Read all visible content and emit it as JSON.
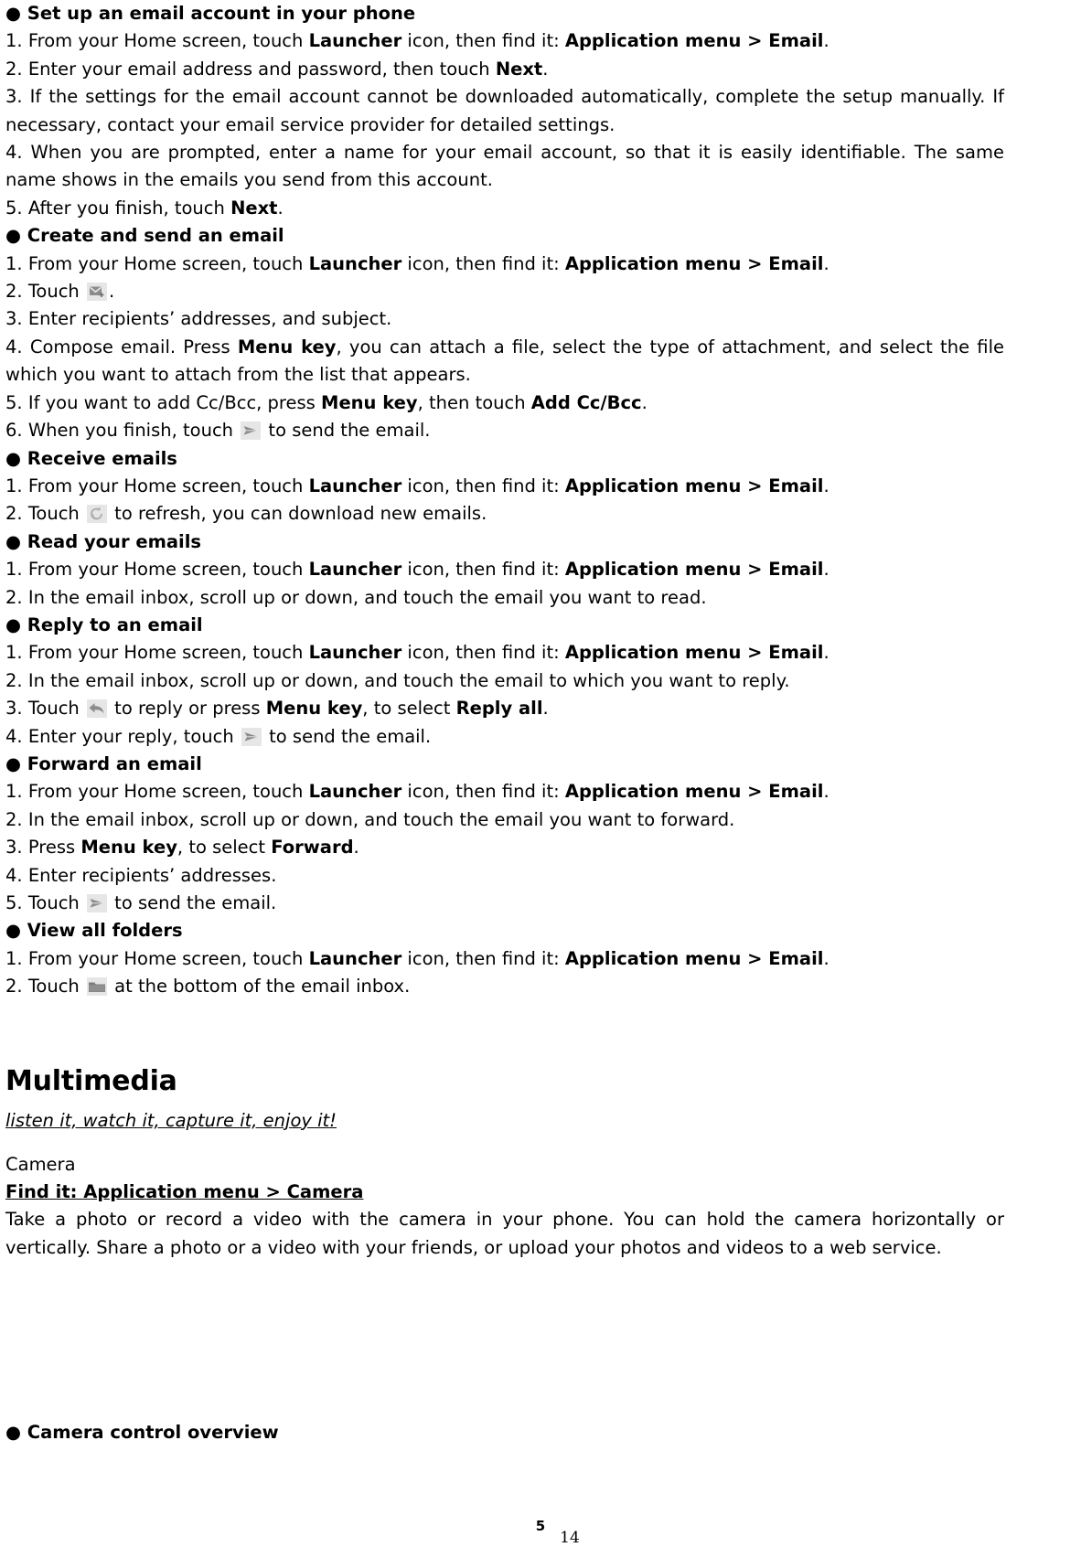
{
  "document": {
    "page_label_inner": "5",
    "page_label_outer": "14"
  },
  "sections": [
    {
      "heading": "● Set up an email account in your phone",
      "steps": [
        {
          "num": "1. ",
          "parts": [
            {
              "t": "From your Home screen, touch ",
              "b": false
            },
            {
              "t": "Launcher",
              "b": true
            },
            {
              "t": " icon, then find it: ",
              "b": false
            },
            {
              "t": "Application menu > Email",
              "b": true
            },
            {
              "t": ".",
              "b": false
            }
          ]
        },
        {
          "num": "2. ",
          "parts": [
            {
              "t": "Enter your email address and password, then touch ",
              "b": false
            },
            {
              "t": "Next",
              "b": true
            },
            {
              "t": ".",
              "b": false
            }
          ]
        },
        {
          "num": "3. ",
          "parts": [
            {
              "t": "If the settings for the email account cannot be downloaded automatically, complete the setup manually. If necessary, contact your email service provider for detailed settings.",
              "b": false
            }
          ]
        },
        {
          "num": "4. ",
          "parts": [
            {
              "t": "When you are prompted, enter a name for your email account, so that it is easily identifiable. The same name shows in the emails you send from this account.",
              "b": false
            }
          ]
        },
        {
          "num": "5. ",
          "parts": [
            {
              "t": "After you finish, touch ",
              "b": false
            },
            {
              "t": "Next",
              "b": true
            },
            {
              "t": ".",
              "b": false
            }
          ]
        }
      ]
    },
    {
      "heading": "● Create and send an email",
      "steps": [
        {
          "num": "1. ",
          "parts": [
            {
              "t": "From your Home screen, touch ",
              "b": false
            },
            {
              "t": "Launcher",
              "b": true
            },
            {
              "t": " icon, then find it: ",
              "b": false
            },
            {
              "t": "Application menu > Email",
              "b": true
            },
            {
              "t": ".",
              "b": false
            }
          ]
        },
        {
          "num": "2. ",
          "parts": [
            {
              "t": "Touch ",
              "b": false
            },
            {
              "icon": "compose-email-icon"
            },
            {
              "t": ".",
              "b": false
            }
          ]
        },
        {
          "num": "3. ",
          "parts": [
            {
              "t": "Enter recipients’ addresses, and subject.",
              "b": false
            }
          ]
        },
        {
          "num": "4. ",
          "parts": [
            {
              "t": "Compose email. Press ",
              "b": false
            },
            {
              "t": "Menu key",
              "b": true
            },
            {
              "t": ", you can attach a file, select the type of attachment, and select the file which you want to attach from the list that appears.",
              "b": false
            }
          ]
        },
        {
          "num": "5. ",
          "parts": [
            {
              "t": "If you want to add Cc/Bcc, press ",
              "b": false
            },
            {
              "t": "Menu key",
              "b": true
            },
            {
              "t": ", then touch ",
              "b": false
            },
            {
              "t": "Add Cc/Bcc",
              "b": true
            },
            {
              "t": ".",
              "b": false
            }
          ]
        },
        {
          "num": "6. ",
          "parts": [
            {
              "t": "When you finish, touch ",
              "b": false
            },
            {
              "icon": "send-icon"
            },
            {
              "t": " to send the email.",
              "b": false
            }
          ]
        }
      ]
    },
    {
      "heading": "● Receive emails",
      "steps": [
        {
          "num": "1. ",
          "parts": [
            {
              "t": "From your Home screen, touch ",
              "b": false
            },
            {
              "t": "Launcher",
              "b": true
            },
            {
              "t": " icon, then find it: ",
              "b": false
            },
            {
              "t": "Application menu > Email",
              "b": true
            },
            {
              "t": ".",
              "b": false
            }
          ]
        },
        {
          "num": "2. ",
          "parts": [
            {
              "t": "Touch ",
              "b": false
            },
            {
              "icon": "refresh-icon"
            },
            {
              "t": " to refresh, you can download new emails.",
              "b": false
            }
          ]
        }
      ]
    },
    {
      "heading": "● Read your emails",
      "steps": [
        {
          "num": "1. ",
          "parts": [
            {
              "t": "From your Home screen, touch ",
              "b": false
            },
            {
              "t": "Launcher",
              "b": true
            },
            {
              "t": " icon, then find it: ",
              "b": false
            },
            {
              "t": "Application menu > Email",
              "b": true
            },
            {
              "t": ".",
              "b": false
            }
          ]
        },
        {
          "num": "2. ",
          "parts": [
            {
              "t": "In the email inbox, scroll up or down, and touch the email you want to read.",
              "b": false
            }
          ]
        }
      ]
    },
    {
      "heading": "● Reply to an email",
      "steps": [
        {
          "num": "1. ",
          "parts": [
            {
              "t": "From your Home screen, touch ",
              "b": false
            },
            {
              "t": "Launcher",
              "b": true
            },
            {
              "t": " icon, then find it: ",
              "b": false
            },
            {
              "t": "Application menu > Email",
              "b": true
            },
            {
              "t": ".",
              "b": false
            }
          ]
        },
        {
          "num": "2. ",
          "parts": [
            {
              "t": "In the email inbox, scroll up or down, and touch the email to which you want to reply.",
              "b": false
            }
          ]
        },
        {
          "num": "3. ",
          "parts": [
            {
              "t": "Touch ",
              "b": false
            },
            {
              "icon": "reply-icon"
            },
            {
              "t": " to reply or press ",
              "b": false
            },
            {
              "t": "Menu key",
              "b": true
            },
            {
              "t": ", to select ",
              "b": false
            },
            {
              "t": "Reply all",
              "b": true
            },
            {
              "t": ".",
              "b": false
            }
          ]
        },
        {
          "num": "4. ",
          "parts": [
            {
              "t": "Enter your reply, touch ",
              "b": false
            },
            {
              "icon": "send-icon"
            },
            {
              "t": " to send the email.",
              "b": false
            }
          ]
        }
      ]
    },
    {
      "heading": "● Forward an email",
      "steps": [
        {
          "num": "1. ",
          "parts": [
            {
              "t": "From your Home screen, touch ",
              "b": false
            },
            {
              "t": "Launcher",
              "b": true
            },
            {
              "t": " icon, then find it: ",
              "b": false
            },
            {
              "t": "Application menu > Email",
              "b": true
            },
            {
              "t": ".",
              "b": false
            }
          ]
        },
        {
          "num": "2. ",
          "parts": [
            {
              "t": "In the email inbox, scroll up or down, and touch the email you want to forward.",
              "b": false
            }
          ]
        },
        {
          "num": "3. ",
          "parts": [
            {
              "t": "Press ",
              "b": false
            },
            {
              "t": "Menu key",
              "b": true
            },
            {
              "t": ", to select ",
              "b": false
            },
            {
              "t": "Forward",
              "b": true
            },
            {
              "t": ".",
              "b": false
            }
          ]
        },
        {
          "num": "4. ",
          "parts": [
            {
              "t": "Enter recipients’ addresses.",
              "b": false
            }
          ]
        },
        {
          "num": "5. ",
          "parts": [
            {
              "t": "Touch ",
              "b": false
            },
            {
              "icon": "send-icon"
            },
            {
              "t": " to send the email.",
              "b": false
            }
          ]
        }
      ]
    },
    {
      "heading": "● View all folders",
      "steps": [
        {
          "num": "1. ",
          "parts": [
            {
              "t": "From your Home screen, touch ",
              "b": false
            },
            {
              "t": "Launcher",
              "b": true
            },
            {
              "t": " icon, then find it: ",
              "b": false
            },
            {
              "t": "Application menu > Email",
              "b": true
            },
            {
              "t": ".",
              "b": false
            }
          ]
        },
        {
          "num": "2. ",
          "parts": [
            {
              "t": "Touch ",
              "b": false
            },
            {
              "icon": "folder-icon"
            },
            {
              "t": " at the bottom of the email inbox.",
              "b": false
            }
          ]
        }
      ]
    }
  ],
  "multimedia": {
    "title": "Multimedia",
    "subtitle": "listen it, watch it, capture it, enjoy it!",
    "camera_label": "Camera",
    "find_it": "Find it: Application menu > Camera",
    "camera_body": "Take a photo or record a video with the camera in your phone. You can hold the camera horizontally or vertically. Share a photo or a video with your friends, or upload your photos and videos to a web service.",
    "camera_control_overview": "● Camera control overview"
  }
}
